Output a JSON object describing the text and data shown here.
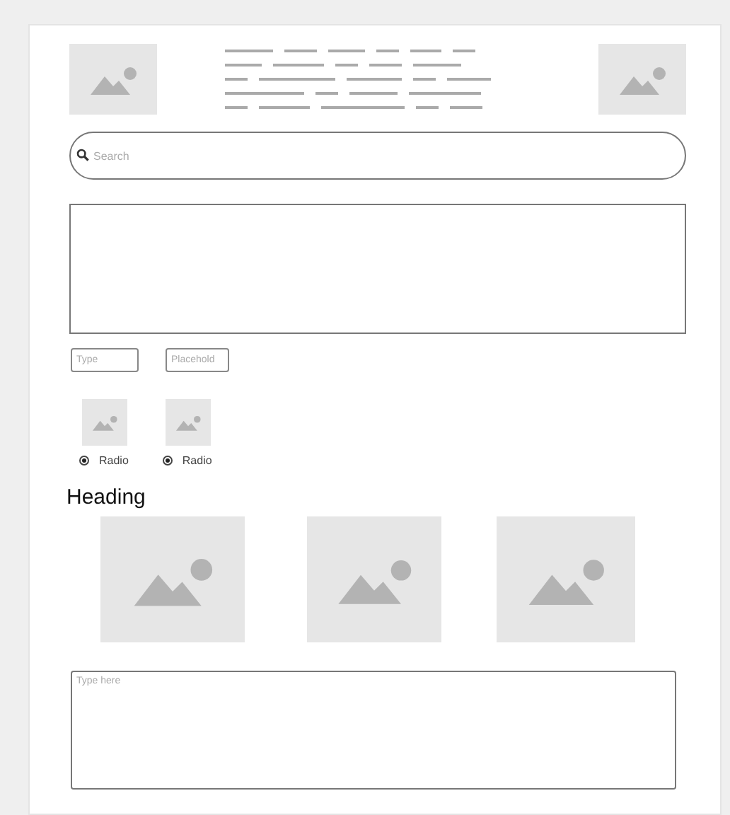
{
  "search": {
    "placeholder": "Search"
  },
  "fields": [
    {
      "placeholder": "Type"
    },
    {
      "placeholder": "Placehold"
    }
  ],
  "radios": [
    {
      "label": "Radio",
      "selected": true
    },
    {
      "label": "Radio",
      "selected": true
    }
  ],
  "heading": "Heading",
  "textarea": {
    "placeholder": "Type here"
  }
}
